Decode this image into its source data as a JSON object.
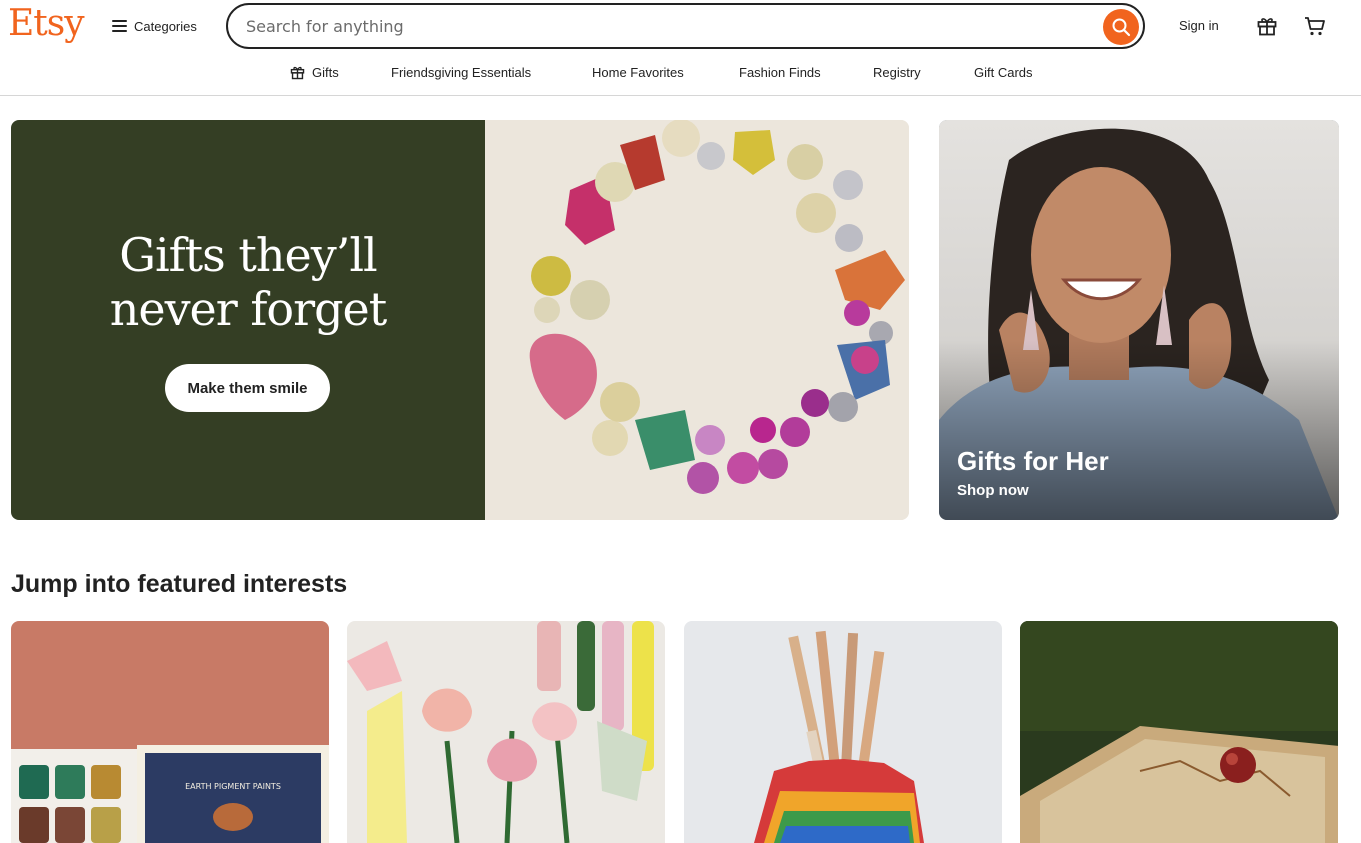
{
  "brand": {
    "logo_text": "Etsy",
    "accent": "#f1641e"
  },
  "header": {
    "categories_label": "Categories",
    "search_placeholder": "Search for anything",
    "signin_label": "Sign in",
    "icons": [
      "menu-icon",
      "search-icon",
      "gift-icon",
      "cart-icon"
    ]
  },
  "nav": {
    "items": [
      {
        "label": "Gifts",
        "icon": "gift-icon"
      },
      {
        "label": "Friendsgiving Essentials"
      },
      {
        "label": "Home Favorites"
      },
      {
        "label": "Fashion Finds"
      },
      {
        "label": "Registry"
      },
      {
        "label": "Gift Cards"
      }
    ]
  },
  "hero": {
    "title_line1": "Gifts they’ll",
    "title_line2": "never forget",
    "cta_label": "Make them smile",
    "bg_color": "#343e24"
  },
  "side_card": {
    "title": "Gifts for Her",
    "subtitle": "Shop now"
  },
  "featured": {
    "title": "Jump into featured interests",
    "tiles": [
      {
        "image": "watercolor-paint-palette"
      },
      {
        "image": "crepe-paper-tulips"
      },
      {
        "image": "rainbow-pencil-holder"
      },
      {
        "image": "wooden-tray-with-apple"
      }
    ],
    "badge_text": "EARTH PIGMENT PAINTS"
  }
}
